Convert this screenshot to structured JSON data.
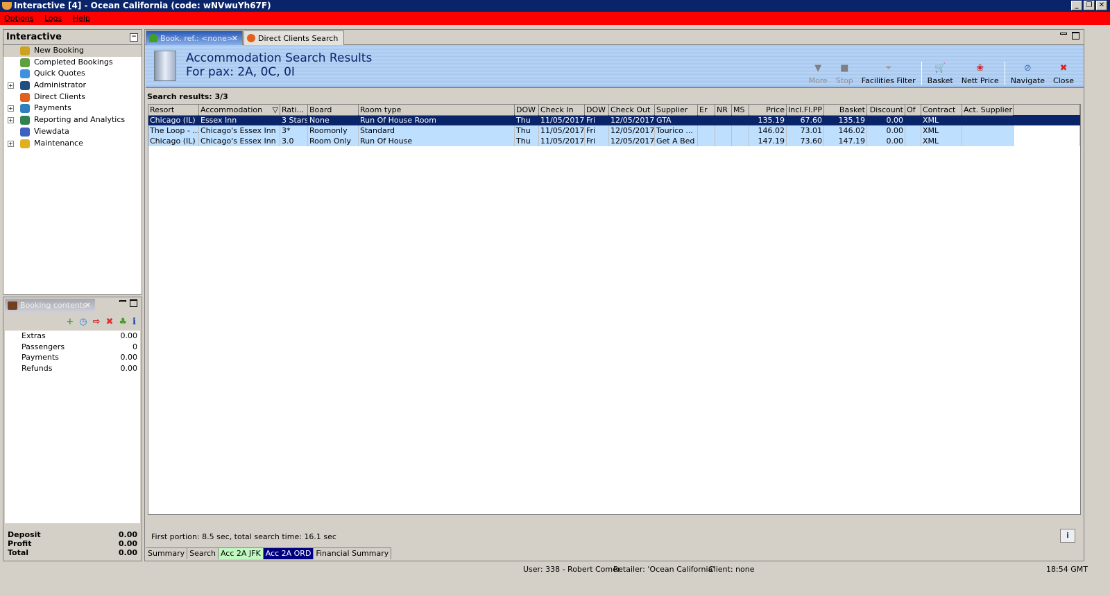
{
  "window": {
    "title": "Interactive [4] - Ocean California (code: wNVwuYh67F)",
    "buttons": [
      "_",
      "❐",
      "✕"
    ]
  },
  "menu": [
    "Options",
    "Logs",
    "Help"
  ],
  "sidebar": {
    "title": "Interactive",
    "collapse": "−",
    "items": [
      {
        "label": "New Booking",
        "expandable": false,
        "selected": true,
        "icon": "palm-tree-icon",
        "color": "#d0a020"
      },
      {
        "label": "Completed Bookings",
        "expandable": false,
        "icon": "palm-money-icon",
        "color": "#60a040"
      },
      {
        "label": "Quick Quotes",
        "expandable": false,
        "icon": "clock-icon",
        "color": "#4090e0"
      },
      {
        "label": "Administrator",
        "expandable": true,
        "icon": "admin-icon",
        "color": "#205080"
      },
      {
        "label": "Direct Clients",
        "expandable": false,
        "icon": "client-icon",
        "color": "#e06020"
      },
      {
        "label": "Payments",
        "expandable": true,
        "icon": "payments-icon",
        "color": "#3080c0"
      },
      {
        "label": "Reporting and Analytics",
        "expandable": true,
        "icon": "report-icon",
        "color": "#308050"
      },
      {
        "label": "Viewdata",
        "expandable": false,
        "icon": "globe-icon",
        "color": "#4060c0"
      },
      {
        "label": "Maintenance",
        "expandable": true,
        "icon": "maintenance-icon",
        "color": "#e0b020"
      }
    ]
  },
  "booking": {
    "tab": "Booking contents",
    "close": "✕",
    "toolbar": [
      "+",
      "◷",
      "⇨",
      "✖",
      "♣",
      "i"
    ],
    "rows": [
      {
        "label": "Extras",
        "value": "0.00"
      },
      {
        "label": "Passengers",
        "value": "0"
      },
      {
        "label": "Payments",
        "value": "0.00"
      },
      {
        "label": "Refunds",
        "value": "0.00"
      }
    ],
    "totals": [
      {
        "label": "Deposit",
        "value": "0.00"
      },
      {
        "label": "Profit",
        "value": "0.00"
      },
      {
        "label": "Total",
        "value": "0.00"
      }
    ]
  },
  "main": {
    "tabs": [
      {
        "label": "Book. ref.: <none>",
        "close": "✕"
      },
      {
        "label": "Direct Clients Search"
      }
    ],
    "title": "Accommodation Search Results",
    "subtitle": "For pax: 2A, 0C, 0I",
    "toolbar": [
      {
        "label": "More",
        "icon": "▼",
        "disabled": true,
        "name": "more"
      },
      {
        "label": "Stop",
        "icon": "■",
        "disabled": true,
        "name": "stop"
      },
      {
        "label": "Facilities Filter",
        "icon": "⏷",
        "name": "facilities-filter"
      },
      {
        "sep": true
      },
      {
        "label": "Basket",
        "icon": "🛒",
        "name": "basket"
      },
      {
        "label": "Nett Price",
        "icon": "❀",
        "name": "nett-price"
      },
      {
        "sep": true
      },
      {
        "label": "Navigate",
        "icon": "⊘",
        "name": "navigate"
      },
      {
        "label": "Close",
        "icon": "✖",
        "name": "close"
      }
    ],
    "results_label": "Search results: 3/3",
    "columns": [
      "Resort",
      "Accommodation",
      "Rati...",
      "Board",
      "Room type",
      "DOW",
      "Check In",
      "DOW",
      "Check Out",
      "Supplier",
      "Er",
      "NR",
      "MS",
      "Price",
      "Incl.Fl.PP",
      "Basket",
      "Discount",
      "Of",
      "Contract",
      "Act. Supplier"
    ],
    "rows": [
      [
        "Chicago (IL)",
        "Essex Inn",
        "3 Stars",
        "None",
        "Run Of House Room",
        "Thu",
        "11/05/2017",
        "Fri",
        "12/05/2017",
        "GTA",
        "",
        "",
        "",
        "135.19",
        "67.60",
        "135.19",
        "0.00",
        "",
        "XML",
        ""
      ],
      [
        "The Loop - ...",
        "Chicago's Essex Inn",
        "3*",
        "Roomonly",
        "Standard",
        "Thu",
        "11/05/2017",
        "Fri",
        "12/05/2017",
        "Tourico ...",
        "",
        "",
        "",
        "146.02",
        "73.01",
        "146.02",
        "0.00",
        "",
        "XML",
        ""
      ],
      [
        "Chicago (IL)",
        "Chicago's Essex Inn",
        "3.0",
        "Room Only",
        "Run  Of House",
        "Thu",
        "11/05/2017",
        "Fri",
        "12/05/2017",
        "Get A Bed",
        "",
        "",
        "",
        "147.19",
        "73.60",
        "147.19",
        "0.00",
        "",
        "XML",
        ""
      ]
    ],
    "selected_row": 0,
    "status": "First portion: 8.5 sec, total search time: 16.1 sec",
    "info": "i",
    "bottom_tabs": [
      {
        "label": "Summary"
      },
      {
        "label": "Search"
      },
      {
        "label": "Acc 2A JFK",
        "color": "#c0f8c0"
      },
      {
        "label": "Acc 2A ORD",
        "active": true
      },
      {
        "label": "Financial Summary"
      }
    ]
  },
  "statusbar": {
    "user": "User: 338 - Robert Comer",
    "retailer": "Retailer: 'Ocean California'",
    "client": "Client: none",
    "time": "18:54 GMT"
  }
}
